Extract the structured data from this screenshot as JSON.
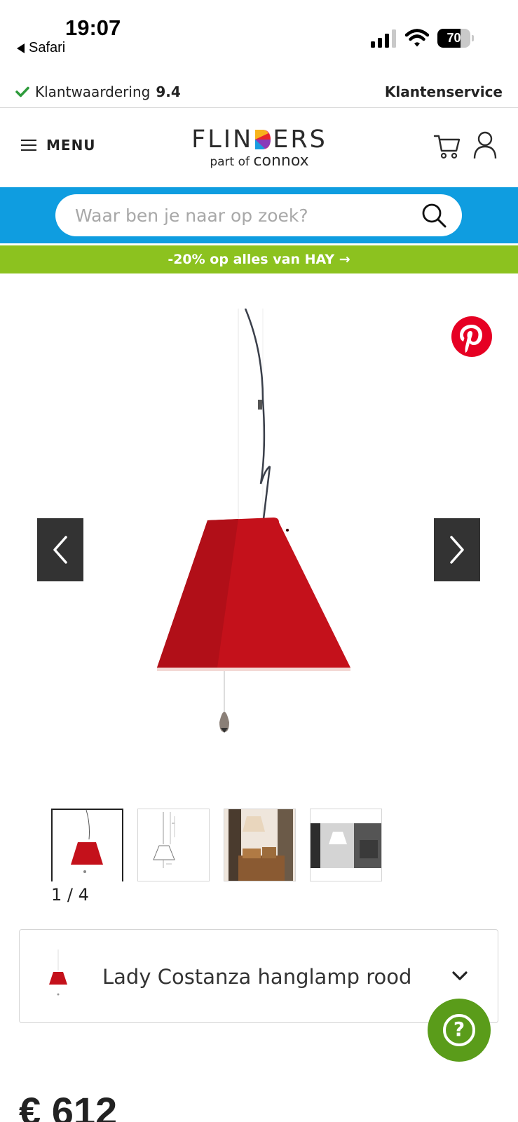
{
  "status_bar": {
    "time": "19:07",
    "back_label": "Safari",
    "battery_level": "70",
    "battery_fraction": 0.7
  },
  "infobar": {
    "rating_label": "Klantwaardering",
    "rating_value": "9.4",
    "service_label": "Klantenservice"
  },
  "header": {
    "menu_label": "MENU",
    "logo_part1": "FLIN",
    "logo_part2": "ERS",
    "logo_sub_prefix": "part of",
    "logo_sub_brand": "connox"
  },
  "search": {
    "placeholder": "Waar ben je naar op zoek?",
    "value": ""
  },
  "promo": {
    "text": "-20% op alles van HAY →"
  },
  "gallery": {
    "counter": "1 / 4",
    "thumbnail_count": 4
  },
  "variant": {
    "label": "Lady Costanza hanglamp rood"
  },
  "price": {
    "text": "€ 612"
  },
  "colors": {
    "search_band": "#0f9de0",
    "promo_band": "#8cc21f",
    "lamp_red": "#c4111b",
    "help_button": "#5a9c1a",
    "pinterest": "#e60023",
    "arrow_bg": "#333333"
  },
  "icons": {
    "back": "back-triangle-icon",
    "signal": "signal-icon",
    "wifi": "wifi-icon",
    "check": "check-icon",
    "menu": "hamburger-icon",
    "cart": "cart-icon",
    "user": "user-icon",
    "search": "search-icon",
    "pinterest": "pinterest-icon",
    "prev": "chevron-left-icon",
    "next": "chevron-right-icon",
    "expand": "chevron-down-icon",
    "help": "question-icon"
  }
}
